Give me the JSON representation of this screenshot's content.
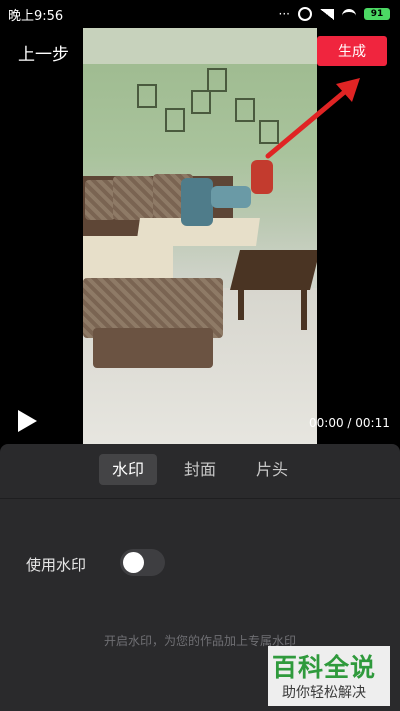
{
  "status_bar": {
    "time": "晚上9:56",
    "battery": "91",
    "icons": [
      "dots-icon",
      "alarm-icon",
      "signal-icon",
      "wifi-icon",
      "battery-icon"
    ]
  },
  "header": {
    "back_label": "上一步",
    "generate_label": "生成",
    "generate_color": "#f0253e"
  },
  "video": {
    "time_display": "00:00 / 00:11",
    "play_icon": "play-icon"
  },
  "panel": {
    "tabs": [
      {
        "label": "水印",
        "active": true
      },
      {
        "label": "封面",
        "active": false
      },
      {
        "label": "片头",
        "active": false
      }
    ],
    "watermark_label": "使用水印",
    "watermark_enabled": false,
    "hint": "开启水印，为您的作品加上专属水印"
  },
  "watermark_logo": {
    "main": "百科全说",
    "sub": "助你轻松解决"
  }
}
